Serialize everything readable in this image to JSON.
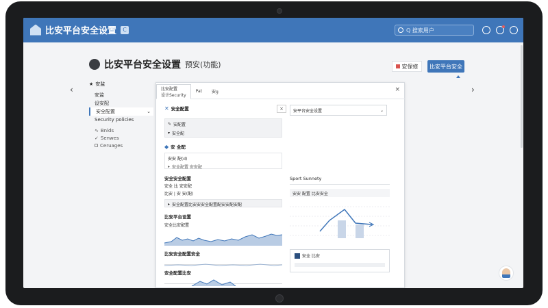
{
  "app": {
    "title": "比安平台安全设置",
    "badge": "C"
  },
  "search": {
    "placeholder": "Q 搜索用户"
  },
  "page": {
    "title": "比安平台安全设置",
    "title_suffix": "预安(功能)",
    "secondary_button": "安保修",
    "primary_button": "比安平台安全"
  },
  "sidebar": {
    "header": "安监",
    "items": [
      {
        "label": "安监"
      },
      {
        "label": "设安配"
      },
      {
        "label": "安全配置"
      },
      {
        "label": "Security policies"
      }
    ],
    "sub_items": [
      {
        "label": "Bnlds"
      },
      {
        "label": "Senwes"
      },
      {
        "label": "Ceruages"
      }
    ]
  },
  "dialog": {
    "tabs": [
      {
        "line1": "比安配置",
        "line2": "设计Security"
      },
      {
        "line1": "Pat",
        "line2": ""
      },
      {
        "label": "安g"
      }
    ],
    "close_glyph": "×",
    "left": {
      "section1_title": "安全配置",
      "section1_row1": "安配置",
      "section1_row2": "安全配",
      "section2_title": "安 全配",
      "section2_block_label": "安安 配(d)",
      "section2_block_sub": "安全配置 安安配",
      "section3_title": "安全安全配置",
      "section3_line1": "安全 比 安安配",
      "section3_line2": "比安 | 安 安(配)",
      "section3_bar": "安全配置比安安安全配置配安安配安配",
      "section4_title": "比安平台设置",
      "section4_chart_label": "安全比安配置",
      "section5_title": "比安安全配置安全",
      "section6_title": "安全配置比安"
    },
    "right": {
      "select_value": "安平台安全设置",
      "summary_title": "Sport Sunnety",
      "summary_line": "安安 配置 比安安全",
      "legend_dots": "安全 比安"
    }
  },
  "icons": {
    "logo": "house-logo-icon",
    "search": "search-icon",
    "notifications": "bell-icon",
    "settings": "gear-icon",
    "avatar": "user-avatar-icon"
  },
  "colors": {
    "brand": "#3f76b9",
    "background": "#f3f4f6"
  }
}
